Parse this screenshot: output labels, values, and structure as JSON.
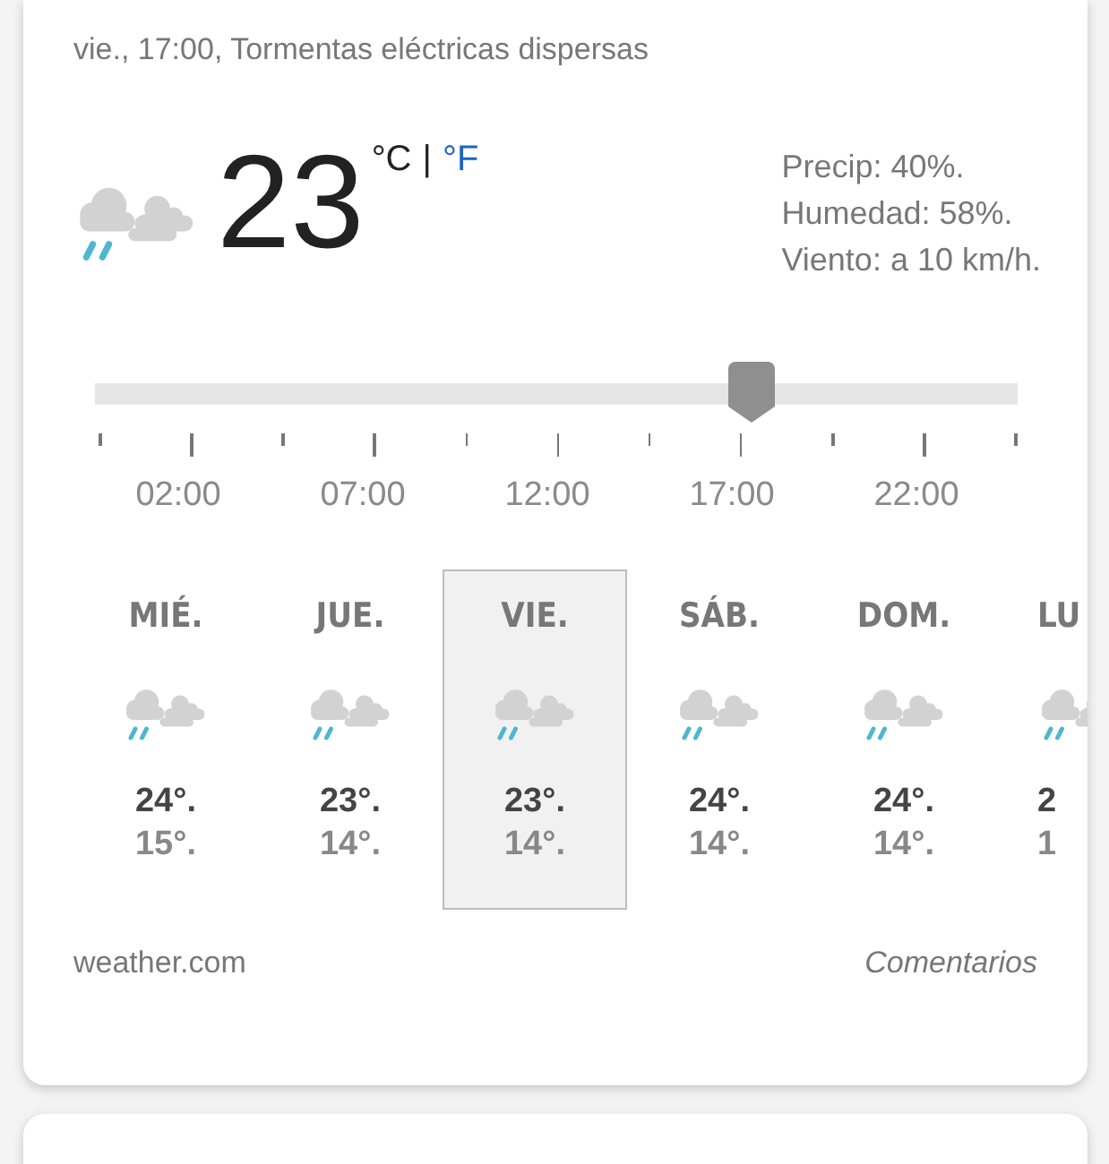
{
  "subtitle": "vie., 17:00, Tormentas eléctricas dispersas",
  "current": {
    "temperature": "23",
    "unit_celsius": "°C",
    "separator": "|",
    "unit_fahrenheit": "°F",
    "details": [
      "Precip: 40%.",
      "Humedad: 58%.",
      "Viento: a 10 km/h."
    ]
  },
  "timeline": {
    "level": 0.71,
    "hours": [
      "02:00",
      "07:00",
      "12:00",
      "17:00",
      "22:00"
    ]
  },
  "days": [
    {
      "name": "MIÉ.",
      "high": "24°.",
      "low": "15°.",
      "selected": false
    },
    {
      "name": "JUE.",
      "high": "23°.",
      "low": "14°.",
      "selected": false
    },
    {
      "name": "VIE.",
      "high": "23°.",
      "low": "14°.",
      "selected": true
    },
    {
      "name": "SÁB.",
      "high": "24°.",
      "low": "14°.",
      "selected": false
    },
    {
      "name": "DOM.",
      "high": "24°.",
      "low": "14°.",
      "selected": false
    },
    {
      "name": "LU",
      "high": "2",
      "low": "1",
      "selected": false
    }
  ],
  "source": "weather.com",
  "feedback": "Comentarios"
}
